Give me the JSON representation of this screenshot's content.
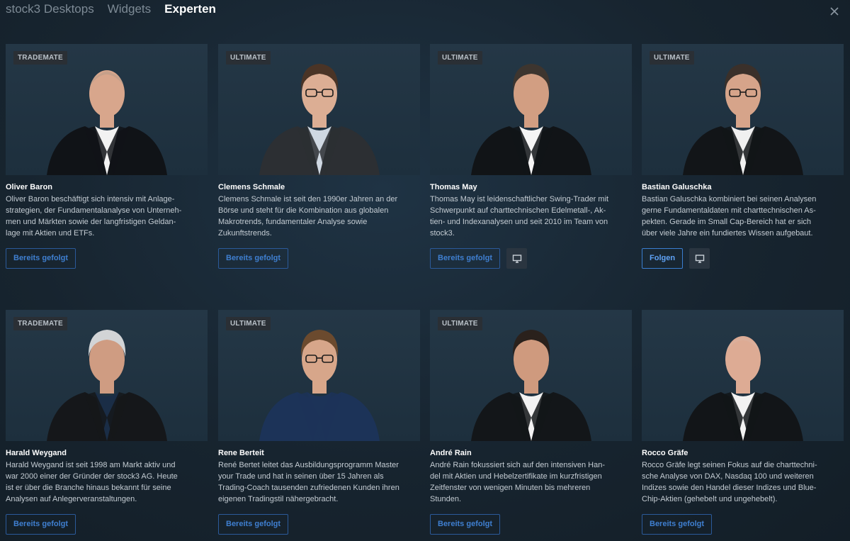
{
  "tabs": [
    {
      "label": "stock3 Desktops",
      "active": false
    },
    {
      "label": "Widgets",
      "active": false
    },
    {
      "label": "Experten",
      "active": true
    }
  ],
  "close_icon": "close-icon",
  "experts": [
    {
      "badge": "TRADEMATE",
      "name": "Oliver Baron",
      "description_lines": [
        "Oliver Baron beschäftigt sich intensiv mit Anlage-",
        "strategien, der Fundamentalanalyse von Unterneh-",
        "men und Märkten sowie der langfristigen Geldan-",
        "lage mit Aktien und ETFs."
      ],
      "button": "Bereits gefolgt",
      "button_style": "following",
      "desktop_button": false,
      "portrait": {
        "hair": "#b89a88",
        "skin": "#d8a68c",
        "jacket": "#101317",
        "shirt": "#f2f2f2",
        "bald": true,
        "glasses": false
      }
    },
    {
      "badge": "ULTIMATE",
      "name": "Clemens Schmale",
      "description_lines": [
        "Clemens Schmale ist seit den 1990er Jahren an der",
        "Börse und steht für die Kombination aus globalen",
        "Makrotrends, fundamentaler Analyse sowie",
        "Zukunftstrends."
      ],
      "button": "Bereits gefolgt",
      "button_style": "following",
      "desktop_button": false,
      "portrait": {
        "hair": "#4a3426",
        "skin": "#dcae94",
        "jacket": "#2c2f33",
        "shirt": "#cfd8e2",
        "bald": false,
        "glasses": true
      }
    },
    {
      "badge": "ULTIMATE",
      "name": "Thomas May",
      "description_lines": [
        "Thomas May ist leidenschaftlicher Swing-Trader mit",
        "Schwerpunkt auf charttechnischen Edelmetall-, Ak-",
        "tien- und Indexanalysen und seit 2010 im Team von",
        "stock3."
      ],
      "button": "Bereits gefolgt",
      "button_style": "following",
      "desktop_button": true,
      "portrait": {
        "hair": "#3d352f",
        "skin": "#d29e82",
        "jacket": "#111417",
        "shirt": "#f5f5f5",
        "bald": false,
        "glasses": false
      }
    },
    {
      "badge": "ULTIMATE",
      "name": "Bastian Galuschka",
      "description_lines": [
        "Bastian Galuschka kombiniert bei seinen Analysen",
        "gerne Fundamentaldaten mit charttechnischen As-",
        "pekten. Gerade im Small Cap-Bereich hat er sich",
        "über viele Jahre ein fundiertes Wissen aufgebaut."
      ],
      "button": "Folgen",
      "button_style": "primary",
      "desktop_button": true,
      "portrait": {
        "hair": "#3a302a",
        "skin": "#d6a48a",
        "jacket": "#121518",
        "shirt": "#f0f0f0",
        "bald": false,
        "glasses": true
      }
    },
    {
      "badge": "TRADEMATE",
      "name": "Harald Weygand",
      "description_lines": [
        "Harald Weygand ist seit 1998 am Markt aktiv und",
        "war 2000 einer der Gründer der stock3 AG. Heute",
        "ist er über die Branche hinaus bekannt für seine",
        "Analysen auf Anlegerveranstaltungen."
      ],
      "button": "Bereits gefolgt",
      "button_style": "following",
      "desktop_button": false,
      "portrait": {
        "hair": "#d2d4d6",
        "skin": "#cf9c82",
        "jacket": "#15171a",
        "shirt": "#1a2d46",
        "bald": false,
        "glasses": false
      }
    },
    {
      "badge": "ULTIMATE",
      "name": "Rene Berteit",
      "description_lines": [
        "René Bertet leitet das Ausbildungsprogramm Master",
        "your Trade und hat in seinen über 15 Jahren als",
        "Trading-Coach tausenden zufriedenen Kunden ihren",
        "eigenen Tradingstil nähergebracht."
      ],
      "button": "Bereits gefolgt",
      "button_style": "following",
      "desktop_button": false,
      "portrait": {
        "hair": "#6b4a2e",
        "skin": "#d7a68a",
        "jacket": "#1c3358",
        "shirt": "#1c3358",
        "bald": false,
        "glasses": true
      }
    },
    {
      "badge": "ULTIMATE",
      "name": "André Rain",
      "description_lines": [
        "André Rain fokussiert sich auf den intensiven Han-",
        "del mit Aktien und Hebelzertifikate im kurzfristigen",
        "Zeitfenster von wenigen Minuten bis mehreren",
        "Stunden."
      ],
      "button": "Bereits gefolgt",
      "button_style": "following",
      "desktop_button": false,
      "portrait": {
        "hair": "#2a211c",
        "skin": "#cf9a7e",
        "jacket": "#131619",
        "shirt": "#f2f2f2",
        "bald": false,
        "glasses": false
      }
    },
    {
      "badge": "",
      "name": "Rocco Gräfe",
      "description_lines": [
        "Rocco Gräfe legt seinen Fokus auf die charttechni-",
        "sche Analyse von DAX, Nasdaq 100 und weiteren",
        "Indizes sowie den Handel dieser Indizes und Blue-",
        "Chip-Aktien (gehebelt und ungehebelt)."
      ],
      "button": "Bereits gefolgt",
      "button_style": "following",
      "desktop_button": false,
      "portrait": {
        "hair": "#d9b2a0",
        "skin": "#ddab94",
        "jacket": "#121518",
        "shirt": "#f2f2f2",
        "bald": true,
        "glasses": false
      }
    }
  ],
  "icons": {
    "desktop": "monitor-icon",
    "close": "close-icon"
  },
  "colors": {
    "background": "#15222d",
    "accent": "#3f7fd0",
    "badge_bg": "#2a2f35"
  }
}
